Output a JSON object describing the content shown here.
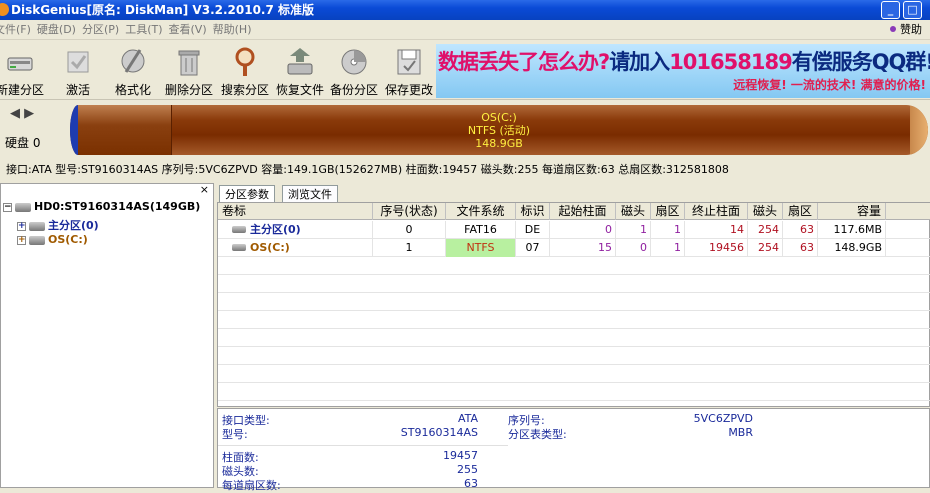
{
  "window": {
    "title": "DiskGenius[原名: DiskMan] V3.2.2010.7 标准版"
  },
  "menu": {
    "items": [
      "文件(F)",
      "硬盘(D)",
      "分区(P)",
      "工具(T)",
      "查看(V)",
      "帮助(H)"
    ],
    "donate": "赞助"
  },
  "toolbar": {
    "items": [
      "新建分区",
      "激活",
      "格式化",
      "删除分区",
      "搜索分区",
      "恢复文件",
      "备份分区",
      "保存更改"
    ]
  },
  "banner": {
    "line1_a": "数据丢失了怎么办?",
    "line1_b": "请加入",
    "line1_c": "101658189",
    "line1_d": "有偿服务QQ群!",
    "line2": "远程恢复!  一流的技术!  满意的价格!"
  },
  "diskbar": {
    "disk_label": "硬盘 0",
    "partition_name": "OS(C:)",
    "partition_fs": "NTFS (活动)",
    "partition_size": "148.9GB"
  },
  "disk_info": "接口:ATA  型号:ST9160314AS  序列号:5VC6ZPVD  容量:149.1GB(152627MB)  柱面数:19457  磁头数:255  每道扇区数:63  总扇区数:312581808",
  "tree": {
    "close": "×",
    "disk": "HD0:ST9160314AS(149GB)",
    "partitions": [
      "主分区(0)",
      "OS(C:)"
    ]
  },
  "tabs": [
    "分区参数",
    "浏览文件"
  ],
  "table": {
    "headers": [
      "卷标",
      "序号(状态)",
      "文件系统",
      "标识",
      "起始柱面",
      "磁头",
      "扇区",
      "终止柱面",
      "磁头",
      "扇区",
      "容量"
    ],
    "rows": [
      [
        "主分区(0)",
        "0",
        "FAT16",
        "DE",
        "0",
        "1",
        "1",
        "14",
        "254",
        "63",
        "117.6MB"
      ],
      [
        "OS(C:)",
        "1",
        "NTFS",
        "07",
        "15",
        "0",
        "1",
        "19456",
        "254",
        "63",
        "148.9GB"
      ]
    ]
  },
  "details": {
    "iface_label": "接口类型:",
    "iface_value": "ATA",
    "serial_label": "序列号:",
    "serial_value": "5VC6ZPVD",
    "model_label": "型号:",
    "model_value": "ST9160314AS",
    "ptable_label": "分区表类型:",
    "ptable_value": "MBR",
    "cyl_label": "柱面数:",
    "cyl_value": "19457",
    "heads_label": "磁头数:",
    "heads_value": "255",
    "spt_label": "每道扇区数:",
    "spt_value": "63"
  },
  "colors": {
    "titlebar": "#0a4ad6",
    "partition_bar": "#7a2c00",
    "partition_text": "#ffef40",
    "ntfs_highlight": "#b8f0a0",
    "detail_text": "#1a2a9a"
  }
}
